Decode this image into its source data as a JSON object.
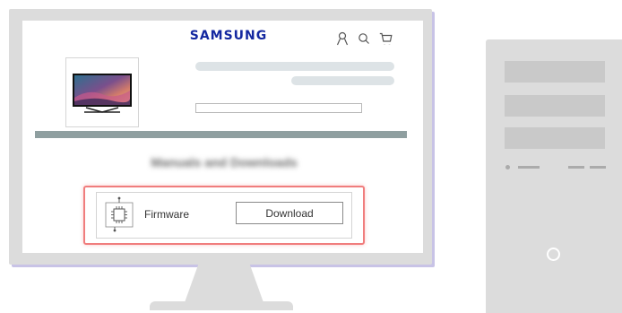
{
  "website": {
    "brand": "SAMSUNG",
    "header_icons": [
      "account-icon",
      "search-icon",
      "cart-icon"
    ],
    "product_image": "tv-product-image",
    "section_heading": "Manuals and Downloads",
    "download_item": {
      "icon": "chip-icon",
      "label": "Firmware",
      "button_label": "Download"
    }
  },
  "colors": {
    "brand": "#1428a0",
    "highlight": "#f07d7d",
    "device": "#dcdcdc",
    "device_shadow": "#c8c3e6"
  }
}
